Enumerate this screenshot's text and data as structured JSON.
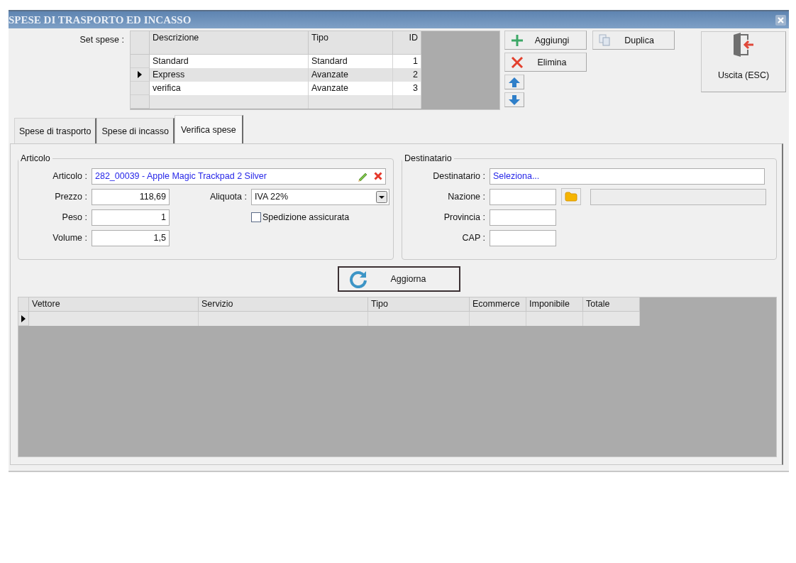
{
  "window": {
    "title": "SPESE DI TRASPORTO ED INCASSO"
  },
  "set_spese": {
    "label": "Set spese :",
    "columns": [
      "Descrizione",
      "Tipo",
      "ID"
    ],
    "rows": [
      {
        "cells": [
          "Standard",
          "Standard",
          "1"
        ],
        "selected": false
      },
      {
        "cells": [
          "Express",
          "Avanzate",
          "2"
        ],
        "selected": true
      },
      {
        "cells": [
          "verifica",
          "Avanzate",
          "3"
        ],
        "selected": false
      }
    ]
  },
  "buttons": [
    {
      "kind": "add",
      "label": "Aggiungi"
    },
    {
      "kind": "duplicate",
      "label": "Duplica"
    },
    {
      "kind": "delete",
      "label": "Elimina"
    },
    {
      "kind": "move_up"
    },
    {
      "kind": "move_down"
    }
  ],
  "exit_button": {
    "label": "Uscita (ESC)"
  },
  "tabs": [
    {
      "label": "Spese di trasporto",
      "selected": false
    },
    {
      "label": "Spese di incasso",
      "selected": false
    },
    {
      "label": "Verifica spese",
      "selected": true
    }
  ],
  "articolo": {
    "title": "Articolo",
    "articolo": {
      "label": "Articolo :",
      "value": "282_00039 - Apple Magic Trackpad 2 Silver"
    },
    "prezzo": {
      "label": "Prezzo :",
      "value": "118,69"
    },
    "peso": {
      "label": "Peso :",
      "value": "1"
    },
    "volume": {
      "label": "Volume :",
      "value": "1,5"
    },
    "aliquota": {
      "label": "Aliquota :",
      "value": "IVA 22%"
    },
    "spedizione_assicurata": {
      "label": "Spedizione assicurata",
      "checked": false
    }
  },
  "destinatario": {
    "title": "Destinatario",
    "destinatario": {
      "label": "Destinatario :",
      "value": "Seleziona..."
    },
    "nazione": {
      "label": "Nazione :"
    },
    "provincia": {
      "label": "Provincia :"
    },
    "cap": {
      "label": "CAP :"
    }
  },
  "refresh_button": {
    "label": "Aggiorna"
  },
  "results": {
    "columns": [
      "Vettore",
      "Servizio",
      "Tipo",
      "Ecommerce",
      "Imponibile",
      "Totale"
    ],
    "rows": [
      {
        "selected": true
      }
    ]
  }
}
